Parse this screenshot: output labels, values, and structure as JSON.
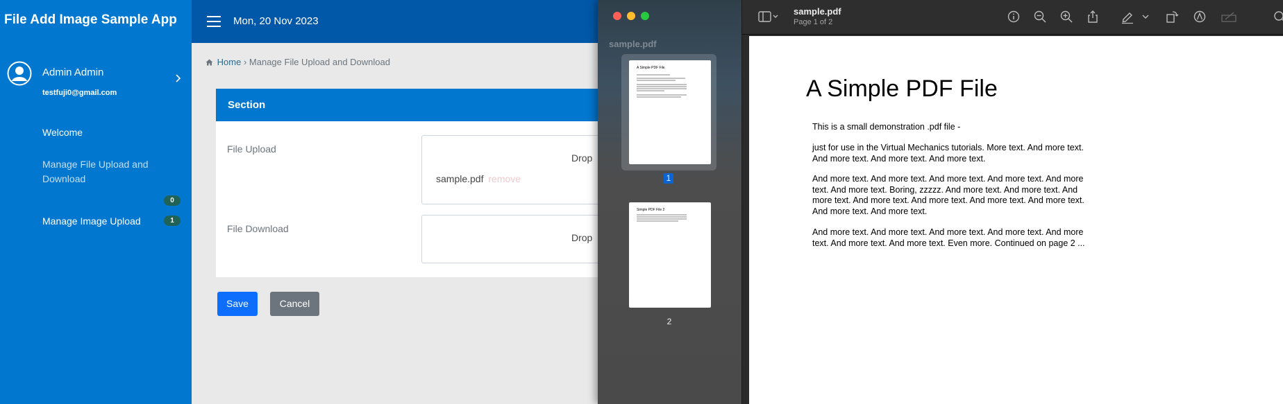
{
  "app": {
    "title": "File Add Image Sample App",
    "user_name": "Admin Admin",
    "user_email": "testfuji0@gmail.com"
  },
  "nav": {
    "welcome": "Welcome",
    "manage_file": "Manage File Upload and Download",
    "manage_image": "Manage Image Upload",
    "badge_file": "0",
    "badge_image": "1"
  },
  "header": {
    "date": "Mon, 20 Nov 2023"
  },
  "breadcrumb": {
    "home": "Home",
    "separator": "›",
    "current": "Manage File Upload and Download"
  },
  "section": {
    "title": "Section",
    "file_upload_label": "File Upload",
    "file_download_label": "File Download",
    "drop_text": "Drop",
    "uploaded_file": "sample.pdf",
    "remove_label": "remove"
  },
  "buttons": {
    "save": "Save",
    "cancel": "Cancel"
  },
  "preview": {
    "sidebar_title": "sample.pdf",
    "filename": "sample.pdf",
    "page_info": "Page 1 of 2",
    "thumb1_title": "A Simple PDF File",
    "thumb2_title": "Simple PDF File 2",
    "page1_num": "1",
    "page2_num": "2"
  },
  "pdf": {
    "title": "A Simple PDF File",
    "para1": "This is a small demonstration .pdf file -",
    "para2": "just for use in the Virtual Mechanics tutorials. More text. And more text. And more text. And more text. And more text.",
    "para3": "And more text. And more text. And more text. And more text. And more text. And more text. Boring, zzzzz. And more text. And more text. And more text. And more text. And more text. And more text. And more text. And more text. And more text.",
    "para4": "And more text. And more text. And more text. And more text. And more text. And more text. And more text. Even more. Continued on page 2 ..."
  },
  "colors": {
    "sidebar": "#0277cf",
    "header": "#0258a8",
    "save": "#0d6efd",
    "cancel": "#6c757d",
    "badge": "#1f6357",
    "selected_page": "#0a64d4"
  },
  "icons": [
    "user-circle-icon",
    "chevron-right-icon",
    "hamburger-icon",
    "home-icon",
    "sidebar-toggle-icon",
    "chevron-down-icon",
    "info-icon",
    "zoom-out-icon",
    "zoom-in-icon",
    "share-icon",
    "pen-icon",
    "rotate-icon",
    "markup-icon",
    "signature-icon",
    "search-icon"
  ]
}
